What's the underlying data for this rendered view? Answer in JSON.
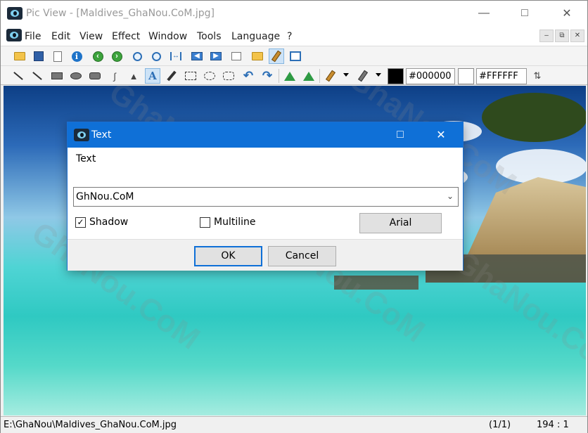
{
  "window": {
    "title": "Pic View - [Maldives_GhaNou.CoM.jpg]"
  },
  "menu": [
    "File",
    "Edit",
    "View",
    "Effect",
    "Window",
    "Tools",
    "Language",
    "?"
  ],
  "toolbar": {
    "foreground_color": "#000000",
    "background_color": "#FFFFFF",
    "foreground_swatch": "#000000",
    "background_swatch": "#ffffff"
  },
  "dialog": {
    "title": "Text",
    "label": "Text",
    "text_value": "GhNou.CoM",
    "shadow_label": "Shadow",
    "shadow_checked": true,
    "multiline_label": "Multiline",
    "multiline_checked": false,
    "font_button": "Arial",
    "ok_label": "OK",
    "cancel_label": "Cancel"
  },
  "status": {
    "path": "E:\\GhaNou\\Maldives_GhaNou.CoM.jpg",
    "pages": "(1/1)",
    "zoom": "194 : 1"
  },
  "watermark": "GhaNou.CoM"
}
